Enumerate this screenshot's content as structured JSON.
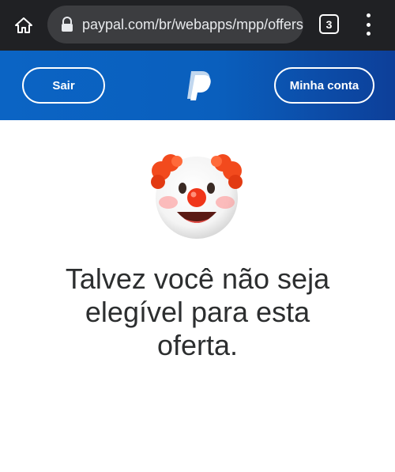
{
  "browser": {
    "url": "paypal.com/br/webapps/mpp/offers?v",
    "tab_count": "3",
    "icons": {
      "home": "home-icon",
      "lock": "lock-icon",
      "menu": "more-vert-icon"
    }
  },
  "header": {
    "logout_label": "Sair",
    "account_label": "Minha conta",
    "logo": "paypal-logo",
    "colors": {
      "gradient_start": "#0b64c4",
      "gradient_end": "#0d3f99"
    }
  },
  "content": {
    "emoji": "clown-face-emoji",
    "message": "Talvez você não seja elegível para esta oferta."
  }
}
